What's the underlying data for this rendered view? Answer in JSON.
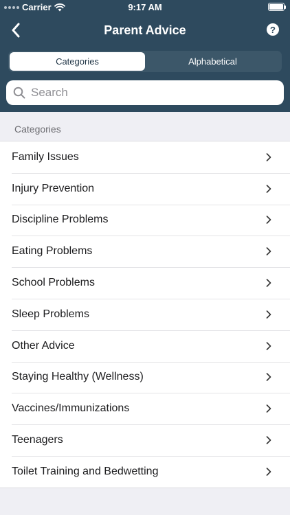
{
  "status": {
    "carrier": "Carrier",
    "time": "9:17 AM"
  },
  "nav": {
    "title": "Parent Advice",
    "help_glyph": "?"
  },
  "tabs": [
    {
      "label": "Categories",
      "active": true
    },
    {
      "label": "Alphabetical",
      "active": false
    }
  ],
  "search": {
    "placeholder": "Search",
    "value": ""
  },
  "section": {
    "header": "Categories"
  },
  "items": [
    {
      "label": "Family Issues"
    },
    {
      "label": "Injury Prevention"
    },
    {
      "label": "Discipline Problems"
    },
    {
      "label": "Eating Problems"
    },
    {
      "label": "School Problems"
    },
    {
      "label": "Sleep Problems"
    },
    {
      "label": "Other Advice"
    },
    {
      "label": "Staying Healthy (Wellness)"
    },
    {
      "label": "Vaccines/Immunizations"
    },
    {
      "label": "Teenagers"
    },
    {
      "label": "Toilet Training and Bedwetting"
    }
  ],
  "colors": {
    "header_bg": "#2e4a5e",
    "page_bg": "#efeff4",
    "segment_bg": "#3c5769"
  },
  "icons": {
    "back": "chevron-left-icon",
    "help": "question-circle-icon",
    "search": "magnifier-icon",
    "row": "chevron-right-icon",
    "wifi": "wifi-icon",
    "battery": "battery-icon"
  }
}
